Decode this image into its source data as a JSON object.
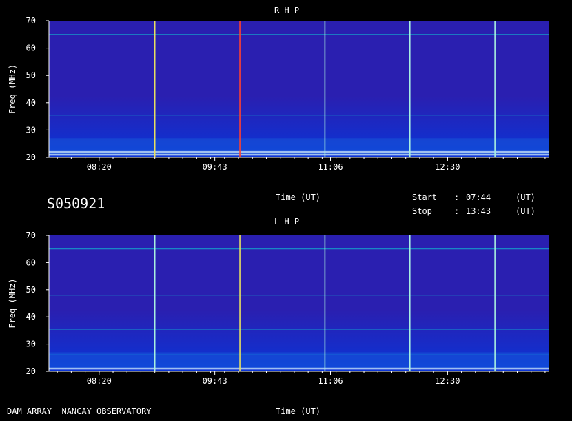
{
  "header_info": {
    "station_id": "S050921",
    "time_axis_label": "Time (UT)",
    "start_label": "Start",
    "start_time": "07:44",
    "stop_label": "Stop",
    "stop_time": "13:43",
    "separator": ":",
    "unit": "(UT)"
  },
  "footer": {
    "observatory": "DAM ARRAY  NANCAY OBSERVATORY",
    "time_axis_label": "Time (UT)"
  },
  "colors": {
    "background": "#000000",
    "spectrogram_base": "#2a1fb0",
    "spectrogram_low": "#0a35d8",
    "band": "#10c0d0",
    "marker_cyan": "#a8f0e0",
    "marker_yellow": "#e8e060",
    "marker_red": "#ff4030"
  },
  "chart_data": [
    {
      "type": "heatmap",
      "title": "R H P",
      "xlabel": "",
      "ylabel": "Freq (MHz)",
      "x_range": [
        "07:44",
        "13:43"
      ],
      "ylim": [
        20,
        70
      ],
      "y_ticks": [
        20,
        30,
        40,
        50,
        60,
        70
      ],
      "x_ticks": [
        "08:20",
        "09:43",
        "11:06",
        "12:30"
      ],
      "vertical_markers": [
        {
          "time": "09:00",
          "color": "marker_yellow"
        },
        {
          "time": "10:01",
          "color": "marker_red"
        },
        {
          "time": "11:02",
          "color": "marker_cyan"
        },
        {
          "time": "12:03",
          "color": "marker_cyan"
        },
        {
          "time": "13:04",
          "color": "marker_cyan"
        }
      ],
      "horizontal_bands_mhz": [
        65,
        35.5,
        22,
        21
      ]
    },
    {
      "type": "heatmap",
      "title": "L H P",
      "xlabel": "",
      "ylabel": "Freq (MHz)",
      "x_range": [
        "07:44",
        "13:43"
      ],
      "ylim": [
        20,
        70
      ],
      "y_ticks": [
        20,
        30,
        40,
        50,
        60,
        70
      ],
      "x_ticks": [
        "08:20",
        "09:43",
        "11:06",
        "12:30"
      ],
      "vertical_markers": [
        {
          "time": "09:00",
          "color": "marker_cyan"
        },
        {
          "time": "10:01",
          "color": "marker_yellow"
        },
        {
          "time": "11:02",
          "color": "marker_cyan"
        },
        {
          "time": "12:03",
          "color": "marker_cyan"
        },
        {
          "time": "13:04",
          "color": "marker_cyan"
        }
      ],
      "horizontal_bands_mhz": [
        65,
        48,
        35.5,
        26,
        21
      ]
    }
  ]
}
